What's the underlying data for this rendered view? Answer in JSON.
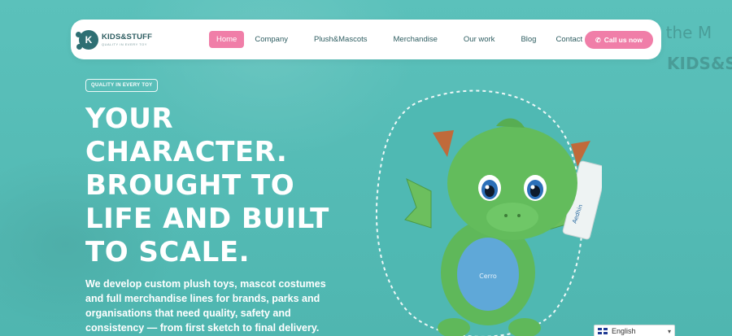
{
  "brand": {
    "name": "KIDS&STUFF",
    "tagline": "QUALITY IN EVERY TOY",
    "logo_letter": "K"
  },
  "nav": {
    "items": [
      {
        "label": "Home",
        "active": true
      },
      {
        "label": "Company"
      },
      {
        "label": "Plush&Mascots"
      },
      {
        "label": "Merchandise"
      },
      {
        "label": "Our work"
      },
      {
        "label": "Blog"
      },
      {
        "label": "Contact"
      }
    ],
    "cta_label": "Call us now",
    "cta_icon": "phone-icon"
  },
  "hero": {
    "badge": "QUALITY IN EVERY TOY",
    "headline_lines": [
      "YOUR",
      "CHARACTER.",
      "BROUGHT TO",
      "LIFE AND BUILT",
      "TO SCALE."
    ],
    "description": "We develop custom plush toys, mascot costumes and full merchandise lines for brands, parks and organisations that need quality, safety and consistency — from first sketch to final delivery."
  },
  "product": {
    "image": "green-dragon-plush-toy",
    "tag_text": "Aedhin",
    "belly_text": "Cerro"
  },
  "background_text": {
    "line1": "e the M",
    "line2": "KIDS&S"
  },
  "language_selector": {
    "value": "English",
    "flag_icon": "uk-flag-icon"
  },
  "colors": {
    "background": "#54bcb6",
    "accent": "#f07ea8",
    "brand_dark": "#2e6f73",
    "dragon_green": "#5fb85a",
    "dragon_belly": "#5fa8d8"
  }
}
